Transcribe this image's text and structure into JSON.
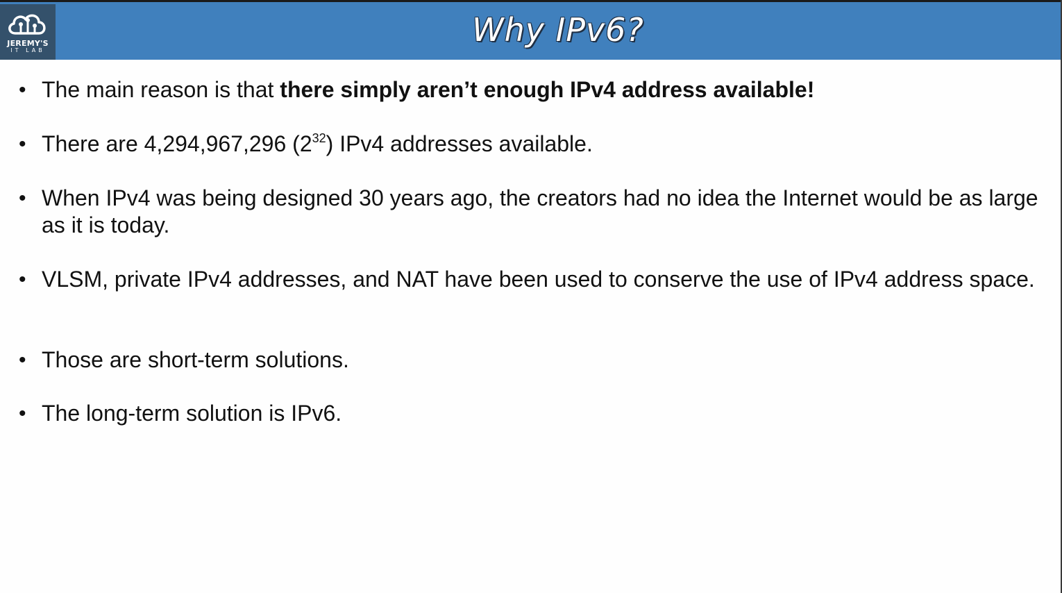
{
  "logo": {
    "line1": "JEREMY'S",
    "line2": "IT LAB",
    "icon": "cloud-circuit-icon"
  },
  "slide": {
    "title": "Why IPv6?",
    "bullets": [
      {
        "pre": "The main reason is that ",
        "bold": "there simply aren’t enough IPv4 address available!"
      },
      {
        "pre": "There are 4,294,967,296 (2",
        "sup": "32",
        "post": ") IPv4 addresses available."
      },
      {
        "text": "When IPv4 was being designed 30 years ago, the creators had no idea the Internet would be as large as it is today."
      },
      {
        "text": "VLSM, private IPv4 addresses, and NAT have been used to conserve the use of IPv4 address space."
      },
      {
        "text": "Those are short-term solutions."
      },
      {
        "text": "The long-term solution is IPv6."
      }
    ]
  },
  "colors": {
    "header": "#4080bd",
    "logo_bg": "#34516b",
    "text": "#111111"
  }
}
